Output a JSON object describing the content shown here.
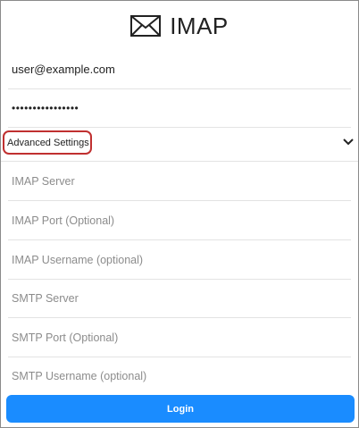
{
  "header": {
    "title": "IMAP",
    "icon": "envelope-icon"
  },
  "form": {
    "email_value": "user@example.com",
    "password_value": "••••••••••••••••",
    "advanced_label": "Advanced Settings",
    "advanced_icon": "chevron-down-icon",
    "fields": {
      "imap_server": "IMAP Server",
      "imap_port": "IMAP Port (Optional)",
      "imap_username": "IMAP Username (optional)",
      "smtp_server": "SMTP Server",
      "smtp_port": "SMTP Port (Optional)",
      "smtp_username": "SMTP Username (optional)"
    },
    "login_label": "Login"
  },
  "colors": {
    "accent": "#1a8cff",
    "highlight": "#c03030"
  }
}
